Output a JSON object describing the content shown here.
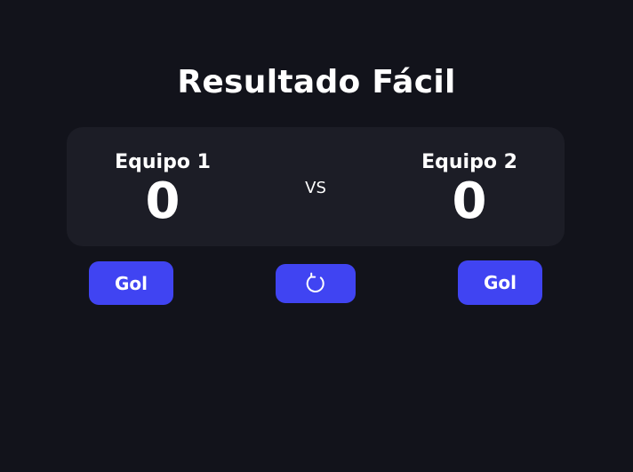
{
  "app": {
    "title": "Resultado Fácil"
  },
  "scoreboard": {
    "team1": {
      "name": "Equipo 1",
      "score": "0"
    },
    "team2": {
      "name": "Equipo 2",
      "score": "0"
    },
    "vs_label": "VS"
  },
  "controls": {
    "team1_goal_label": "Gol",
    "team2_goal_label": "Gol",
    "reset_icon": "refresh-icon"
  },
  "colors": {
    "background": "#12131b",
    "card": "#1c1d26",
    "accent": "#4044f2",
    "text": "#ffffff"
  }
}
